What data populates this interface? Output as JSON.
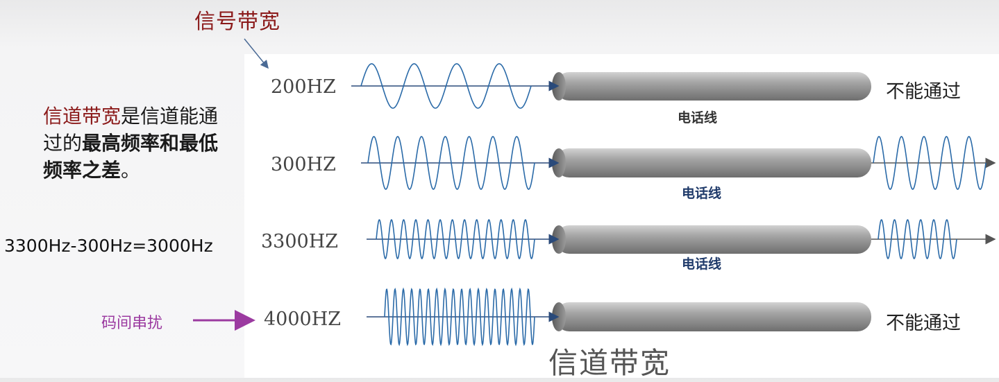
{
  "title_top": "信号带宽",
  "description": {
    "highlight": "信道带宽",
    "text_normal": "是信道能通过的",
    "text_bold": "最高频率和最低频率之差",
    "text_end": "。"
  },
  "formula": "3300Hz-300Hz=3000Hz",
  "intersymbol_label": "码间串扰",
  "bottom_title": "信道带宽",
  "rows": [
    {
      "freq": "200HZ",
      "wire_label": "电话线",
      "result": "不能通过",
      "cycles": 4,
      "passes": false
    },
    {
      "freq": "300HZ",
      "wire_label": "电话线",
      "result": "",
      "cycles": 7,
      "passes": true
    },
    {
      "freq": "3300HZ",
      "wire_label": "电话线",
      "result": "",
      "cycles": 13,
      "passes": true
    },
    {
      "freq": "4000HZ",
      "wire_label": "",
      "result": "不能通过",
      "cycles": 18,
      "passes": false
    }
  ],
  "colors": {
    "wave": "#2a6aa8",
    "cable": "#8c8c8c",
    "title_red": "#8b1a1a",
    "arrow_purple": "#9b3aa0"
  }
}
